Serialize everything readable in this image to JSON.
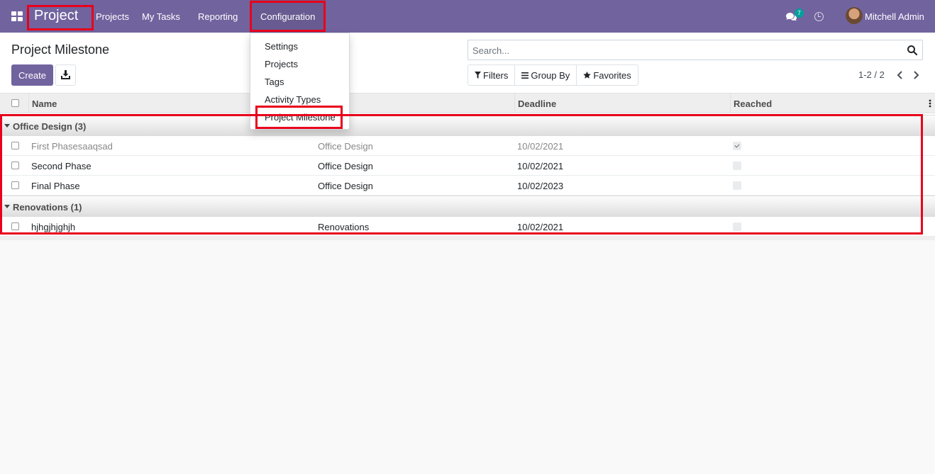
{
  "navbar": {
    "app_name": "Project",
    "menu": [
      "Projects",
      "My Tasks",
      "Reporting",
      "Configuration"
    ],
    "chat_count": "7",
    "user_name": "Mitchell Admin"
  },
  "config_menu": [
    "Settings",
    "Projects",
    "Tags",
    "Activity Types",
    "Project Milestone"
  ],
  "control_panel": {
    "title": "Project Milestone",
    "create_label": "Create",
    "search_placeholder": "Search...",
    "filters_label": "Filters",
    "groupby_label": "Group By",
    "favorites_label": "Favorites",
    "pager": "1-2 / 2"
  },
  "table": {
    "headers": {
      "name": "Name",
      "deadline": "Deadline",
      "reached": "Reached"
    },
    "groups": [
      {
        "label": "Office Design (3)",
        "rows": [
          {
            "name": "First Phasesaaqsad",
            "project": "Office Design",
            "deadline": "10/02/2021",
            "reached": true
          },
          {
            "name": "Second Phase",
            "project": "Office Design",
            "deadline": "10/02/2021",
            "reached": false
          },
          {
            "name": "Final Phase",
            "project": "Office Design",
            "deadline": "10/02/2023",
            "reached": false
          }
        ]
      },
      {
        "label": "Renovations (1)",
        "rows": [
          {
            "name": "hjhgjhjghjh",
            "project": "Renovations",
            "deadline": "10/02/2021",
            "reached": false
          }
        ]
      }
    ]
  },
  "colors": {
    "brand": "#71639e",
    "highlight": "#e8001c",
    "badge": "#00a09d"
  }
}
